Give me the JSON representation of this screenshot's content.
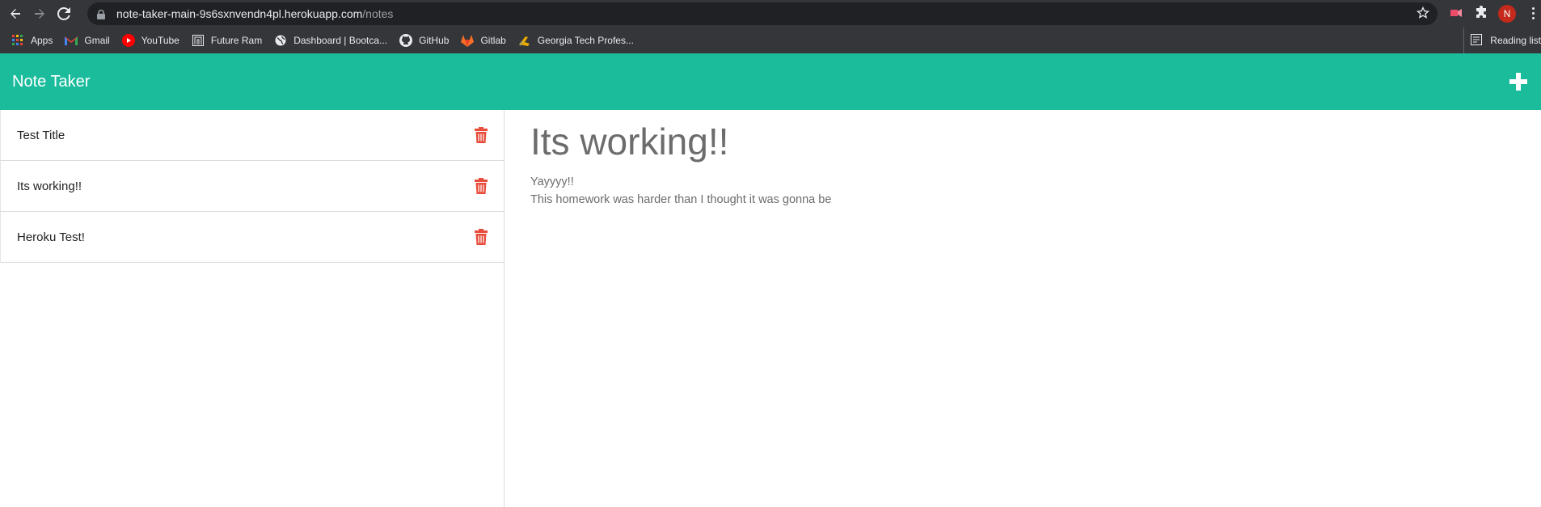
{
  "browser": {
    "url_host": "note-taker-main-9s6sxnvendn4pl.herokuapp.com",
    "url_path": "/notes",
    "profile_initial": "N",
    "bookmarks": [
      {
        "label": "Apps",
        "icon": "apps-grid-icon"
      },
      {
        "label": "Gmail",
        "icon": "gmail-icon"
      },
      {
        "label": "YouTube",
        "icon": "youtube-icon"
      },
      {
        "label": "Future Ram",
        "icon": "future-ram-icon"
      },
      {
        "label": "Dashboard | Bootca...",
        "icon": "globe-icon"
      },
      {
        "label": "GitHub",
        "icon": "github-icon"
      },
      {
        "label": "Gitlab",
        "icon": "gitlab-icon"
      },
      {
        "label": "Georgia Tech Profes...",
        "icon": "georgia-tech-icon"
      }
    ],
    "reading_list_label": "Reading list"
  },
  "app": {
    "title": "Note Taker",
    "accent_color": "#1abc9c",
    "delete_color": "#e74c3c"
  },
  "notes": [
    {
      "title": "Test Title"
    },
    {
      "title": "Its working!!"
    },
    {
      "title": "Heroku Test!"
    }
  ],
  "active_note": {
    "title": "Its working!!",
    "text": "Yayyyy!!\nThis homework was harder than I thought it was gonna be"
  }
}
